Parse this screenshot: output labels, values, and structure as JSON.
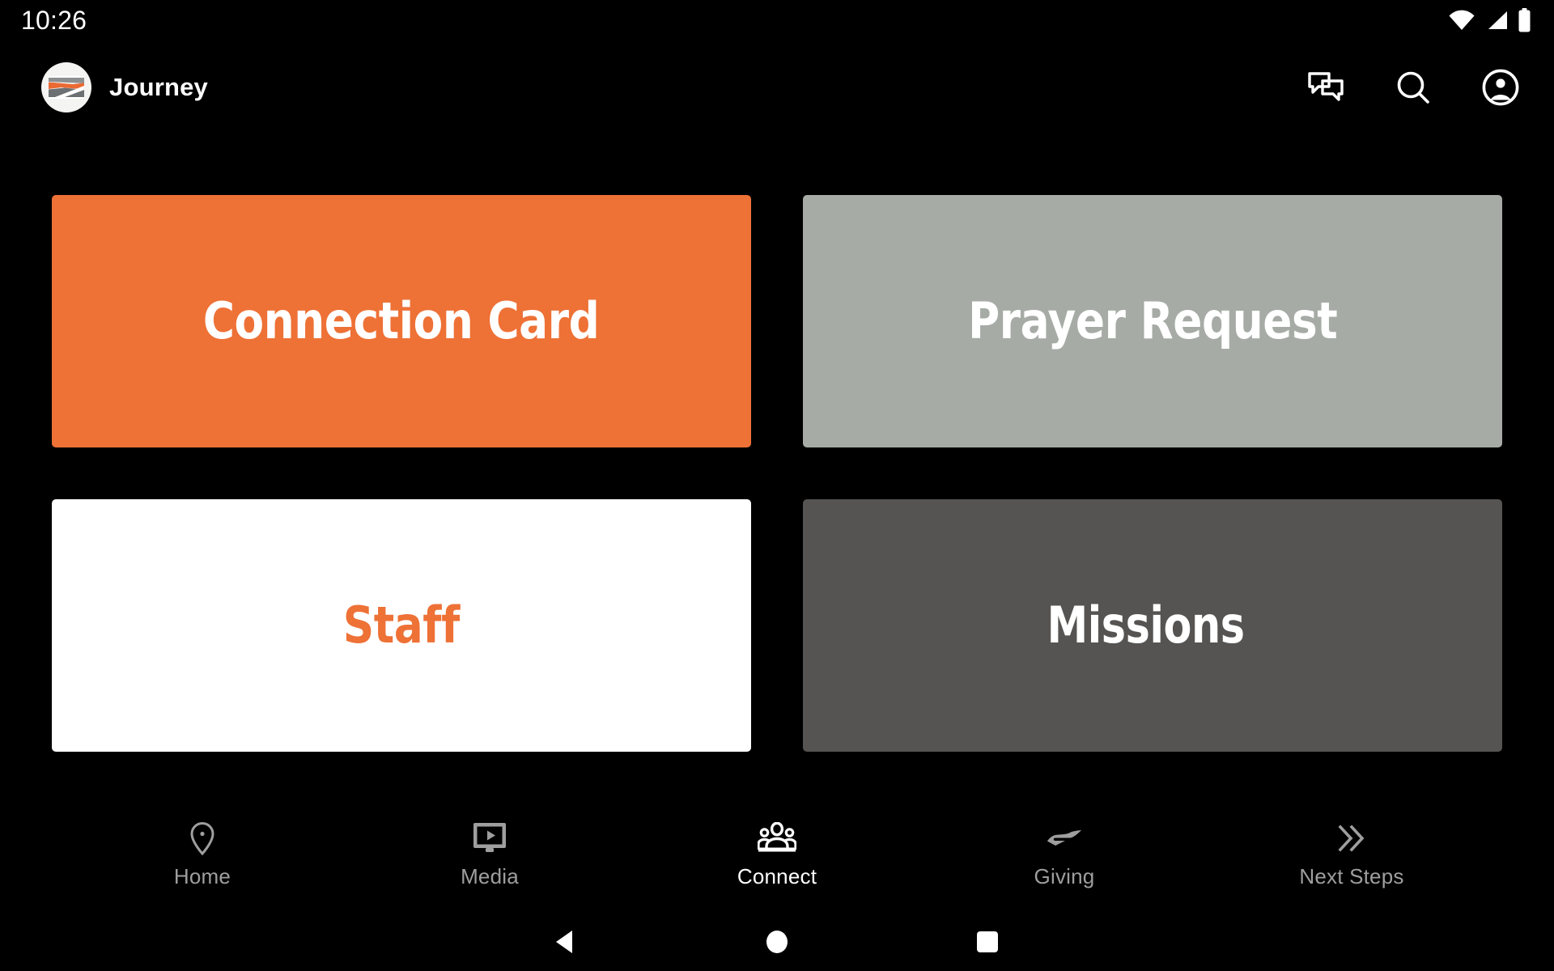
{
  "status_bar": {
    "time": "10:26",
    "icons": [
      "wifi-icon",
      "cellular-signal-icon",
      "battery-icon"
    ]
  },
  "app_bar": {
    "brand_name": "Journey",
    "logo_icon": "journey-logo-icon",
    "actions": [
      {
        "name": "messages-icon",
        "label": "Messages"
      },
      {
        "name": "search-icon",
        "label": "Search"
      },
      {
        "name": "account-circle-icon",
        "label": "Account"
      }
    ]
  },
  "tiles": [
    {
      "label": "Connection Card",
      "bg": "#ee7136",
      "text_color": "#ffffff"
    },
    {
      "label": "Prayer Request",
      "bg": "#a6aba6",
      "text_color": "#ffffff"
    },
    {
      "label": "Staff",
      "bg": "#ffffff",
      "text_color": "#ee7136"
    },
    {
      "label": "Missions",
      "bg": "#565452",
      "text_color": "#ffffff"
    }
  ],
  "bottom_nav": {
    "items": [
      {
        "label": "Home",
        "icon": "location-pin-icon",
        "active": false
      },
      {
        "label": "Media",
        "icon": "media-screen-play-icon",
        "active": false
      },
      {
        "label": "Connect",
        "icon": "people-group-icon",
        "active": true
      },
      {
        "label": "Giving",
        "icon": "giving-hand-icon",
        "active": false
      },
      {
        "label": "Next Steps",
        "icon": "double-chevron-right-icon",
        "active": false
      }
    ],
    "active_color": "#ffffff",
    "inactive_color": "#9e9e9e"
  },
  "system_nav": {
    "buttons": [
      {
        "name": "android-back-button",
        "icon": "triangle-left-icon"
      },
      {
        "name": "android-home-button",
        "icon": "circle-icon"
      },
      {
        "name": "android-recents-button",
        "icon": "square-icon"
      }
    ]
  }
}
